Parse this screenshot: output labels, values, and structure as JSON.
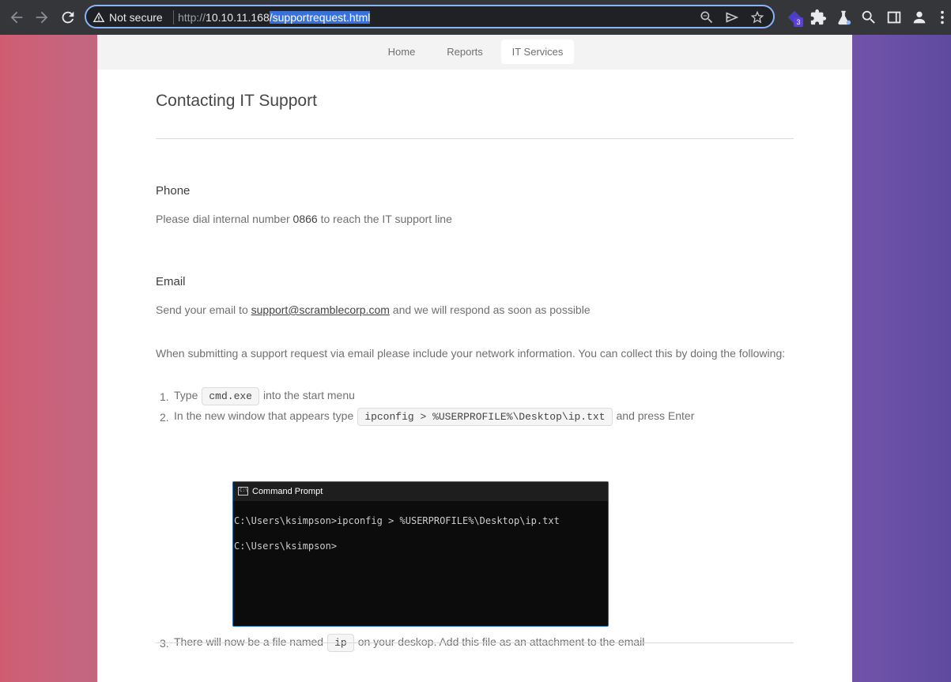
{
  "browser": {
    "security_label": "Not secure",
    "url_scheme": "http://",
    "url_host": "10.10.11.168",
    "url_path": "/supportrequest.html",
    "extension_badge": "3"
  },
  "nav": {
    "items": [
      {
        "label": "Home"
      },
      {
        "label": "Reports"
      },
      {
        "label": "IT Services",
        "active": true
      }
    ]
  },
  "page": {
    "title": "Contacting IT Support",
    "phone": {
      "heading": "Phone",
      "text_before": "Please dial internal number ",
      "number": "0866",
      "text_after": " to reach the IT support line"
    },
    "email": {
      "heading": "Email",
      "text_before": "Send your email to ",
      "address": "support@scramblecorp.com",
      "text_after": " and we will respond as soon as possible",
      "instructions": "When submitting a support request via email please include your network information. You can collect this by doing the following:"
    },
    "steps": [
      {
        "number": "1.",
        "before": "Type",
        "code": "cmd.exe",
        "after": "into the start menu"
      },
      {
        "number": "2.",
        "before": "In the new window that appears type",
        "code": "ipconfig > %USERPROFILE%\\Desktop\\ip.txt",
        "after": "and press Enter"
      },
      {
        "number": "3.",
        "before": "There will now be a file named",
        "code": "ip",
        "after": "on your deskop. Add this file as an attachment to the email"
      }
    ],
    "cmd_window": {
      "title": "Command Prompt",
      "line1": "C:\\Users\\ksimpson>ipconfig > %USERPROFILE%\\Desktop\\ip.txt",
      "line2": "C:\\Users\\ksimpson>"
    }
  }
}
